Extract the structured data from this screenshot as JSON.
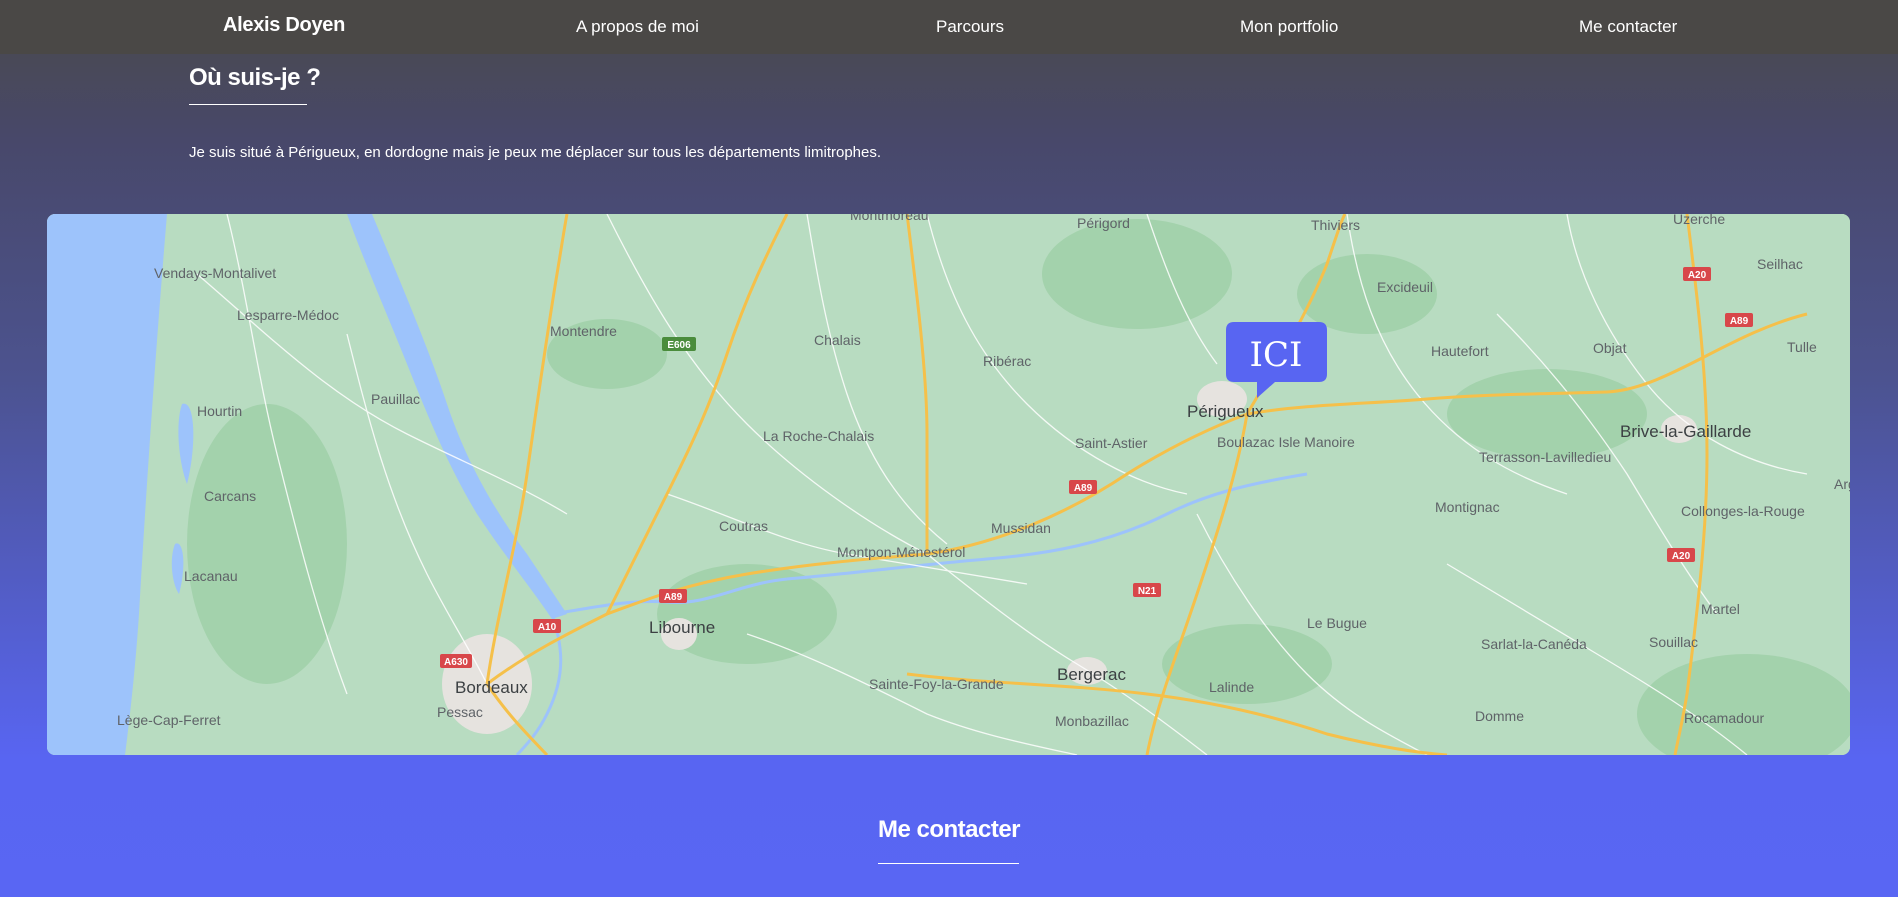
{
  "navbar": {
    "brand": "Alexis Doyen",
    "links": [
      {
        "label": "A propos de moi"
      },
      {
        "label": "Parcours"
      },
      {
        "label": "Mon portfolio"
      },
      {
        "label": "Me contacter"
      }
    ]
  },
  "location_section": {
    "title": "Où suis-je ?",
    "description": "Je suis situé à Périgueux, en dordogne mais je peux me déplacer sur tous les départements limitrophes."
  },
  "map": {
    "marker_label": "ICI",
    "marker_color": "#5865f2",
    "land_color": "#b8dcc1",
    "water_color": "#9dc3fb",
    "road_color": "#f5c04a",
    "towns": [
      "Vendays-Montalivet",
      "Lesparre-Médoc",
      "Montendre",
      "Chalais",
      "Ribérac",
      "Périgord",
      "Montmoreau",
      "Thiviers",
      "Excideuil",
      "Uzerche",
      "Seilhac",
      "Hautefort",
      "Objat",
      "Tulle",
      "Pauillac",
      "Hourtin",
      "Carcans",
      "Lacanau",
      "La Roche-Chalais",
      "Saint-Astier",
      "Périgueux",
      "Boulazac Isle Manoire",
      "Terrasson-Lavilledieu",
      "Brive-la-Gaillarde",
      "Coutras",
      "Mussidan",
      "Montpon-Ménestérol",
      "Montignac",
      "Collonges-la-Rouge",
      "Libourne",
      "Le Bugue",
      "Martel",
      "Sarlat-la-Canéda",
      "Souillac",
      "Bordeaux",
      "Pessac",
      "Sainte-Foy-la-Grande",
      "Bergerac",
      "Lalinde",
      "Lège-Cap-Ferret",
      "Monbazillac",
      "Domme",
      "Rocamadour",
      "Arg"
    ],
    "road_shields": [
      "E606",
      "A89",
      "A89",
      "A10",
      "A630",
      "A89",
      "N21",
      "A20",
      "A89",
      "A20"
    ]
  },
  "contact_section": {
    "title": "Me contacter"
  }
}
